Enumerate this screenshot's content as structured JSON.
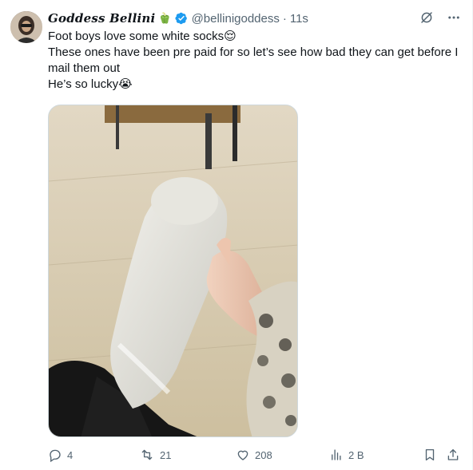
{
  "author": {
    "display_name": "Goddess Bellini",
    "name_emoji": "🫑",
    "handle": "@bellinigoddess",
    "separator": "·",
    "time": "11s"
  },
  "tweet": {
    "lines": [
      "Foot boys love some white socks😌",
      "These ones have been pre paid for so let’s see how bad they can get before I mail them out",
      "He’s so lucky😭"
    ]
  },
  "stats": {
    "replies": "4",
    "retweets": "21",
    "likes": "208",
    "views": "2 B"
  },
  "colors": {
    "verified": "#1d9bf0",
    "secondary_text": "#536471",
    "primary_text": "#0f1419"
  }
}
